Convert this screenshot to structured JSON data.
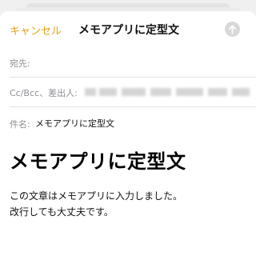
{
  "nav": {
    "cancel_label": "キャンセル",
    "title": "メモアプリに定型文",
    "send_icon": "arrow-up-icon",
    "accent_color": "#e6a01b"
  },
  "fields": {
    "to_label": "宛先:",
    "to_value": "",
    "cc_label": "Cc/Bcc、差出人:",
    "subject_label": "件名:",
    "subject_value": "メモアプリに定型文"
  },
  "body": {
    "heading": "メモアプリに定型文",
    "lines": [
      "この文章はメモアプリに入力しました。",
      "改行しても大丈夫です。"
    ]
  }
}
